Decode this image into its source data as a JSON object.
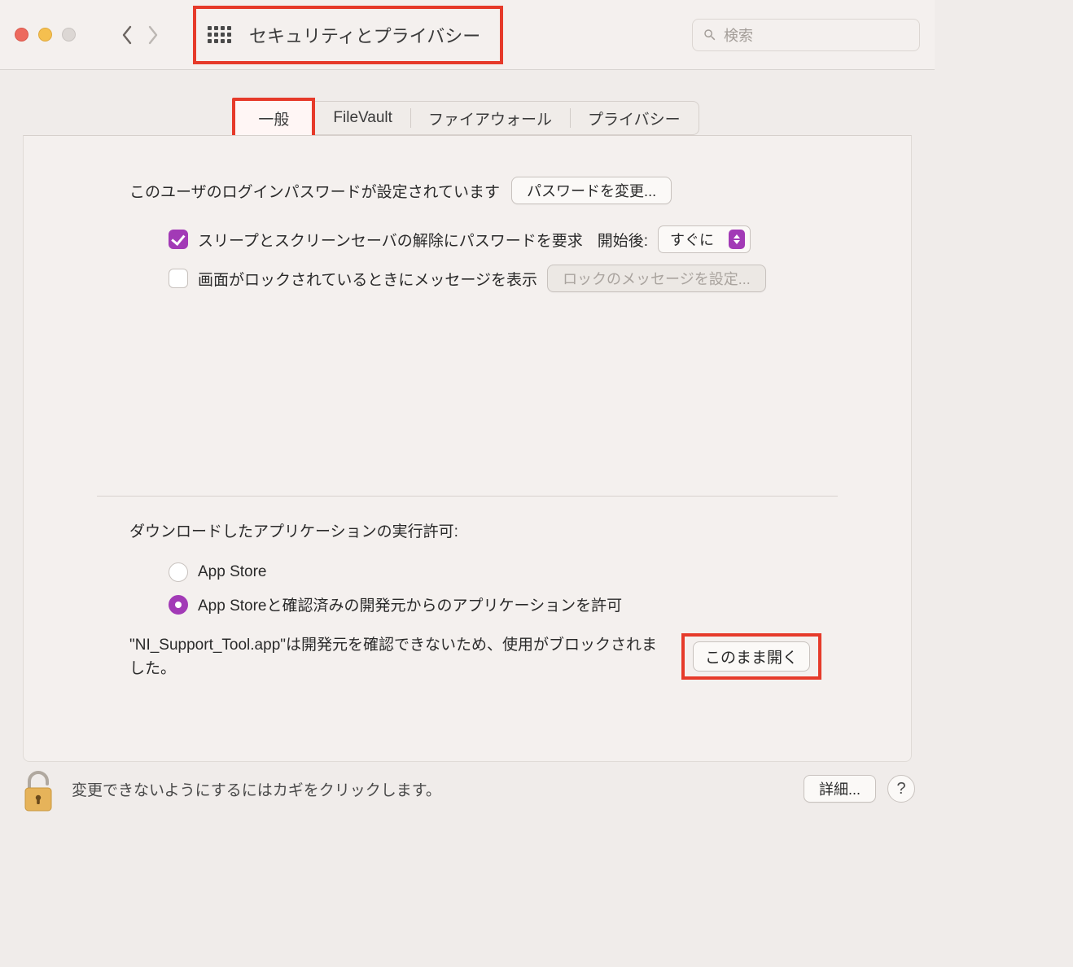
{
  "window": {
    "title": "セキュリティとプライバシー"
  },
  "search": {
    "placeholder": "検索"
  },
  "tabs": {
    "general": "一般",
    "filevault": "FileVault",
    "firewall": "ファイアウォール",
    "privacy": "プライバシー"
  },
  "general": {
    "login_password_set": "このユーザのログインパスワードが設定されています",
    "change_password_btn": "パスワードを変更...",
    "require_password_label": "スリープとスクリーンセーバの解除にパスワードを要求",
    "require_password_after_label": "開始後:",
    "require_password_after_value": "すぐに",
    "show_message_label": "画面がロックされているときにメッセージを表示",
    "set_lock_message_btn": "ロックのメッセージを設定..."
  },
  "downloads": {
    "title": "ダウンロードしたアプリケーションの実行許可:",
    "option_app_store": "App Store",
    "option_identified": "App Storeと確認済みの開発元からのアプリケーションを許可",
    "blocked_message": "\"NI_Support_Tool.app\"は開発元を確認できないため、使用がブロックされました。",
    "open_anyway_btn": "このまま開く"
  },
  "footer": {
    "lock_text": "変更できないようにするにはカギをクリックします。",
    "advanced_btn": "詳細...",
    "help": "?"
  }
}
